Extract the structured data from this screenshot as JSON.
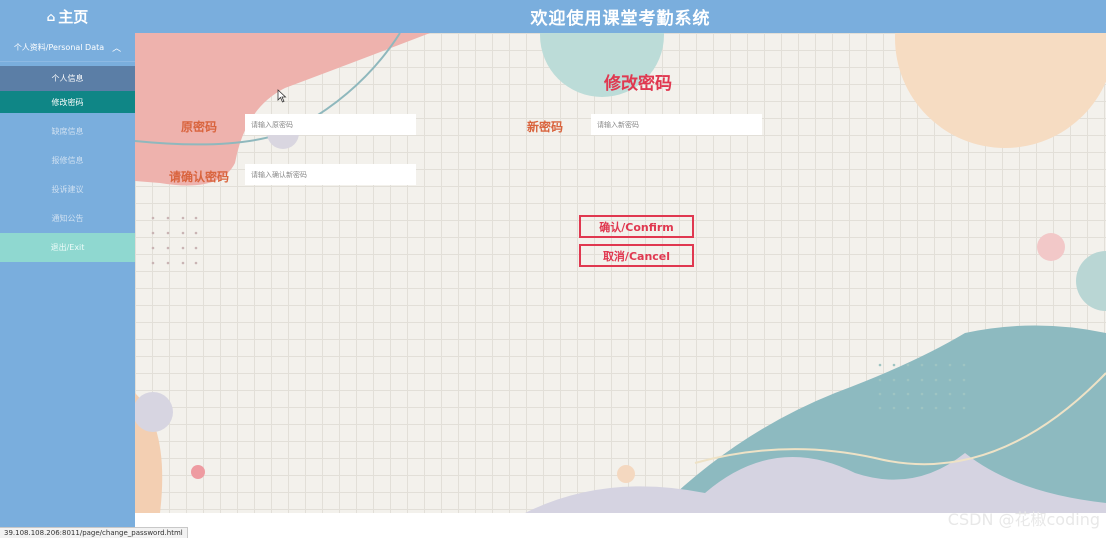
{
  "header": {
    "home_icon": "home-icon",
    "home_label": "主页",
    "title": "欢迎使用课堂考勤系统",
    "bg_color": "#7aaedd"
  },
  "sidebar": {
    "group_label": "个人资料/Personal Data",
    "group_chevron": "chevron-up-icon",
    "sub_items": [
      {
        "label": "个人信息"
      },
      {
        "label": "修改密码"
      }
    ],
    "items": [
      {
        "label": "缺席信息"
      },
      {
        "label": "报修信息"
      },
      {
        "label": "投诉建议"
      },
      {
        "label": "通知公告"
      },
      {
        "label": "退出/Exit"
      }
    ],
    "active_color": "#0f8686",
    "exit_color": "#8fd8d0"
  },
  "form": {
    "title": "修改密码",
    "old_password": {
      "label": "原密码",
      "placeholder": "请输入原密码"
    },
    "new_password": {
      "label": "新密码",
      "placeholder": "请输入新密码"
    },
    "confirm_password": {
      "label": "请确认密码",
      "placeholder": "请输入确认新密码"
    },
    "confirm_button": "确认/Confirm",
    "cancel_button": "取消/Cancel",
    "accent_color": "#e03850",
    "label_color": "#d9643e"
  },
  "status_url": "39.108.108.206:8011/page/change_password.html",
  "watermark": "CSDN @花椒coding"
}
